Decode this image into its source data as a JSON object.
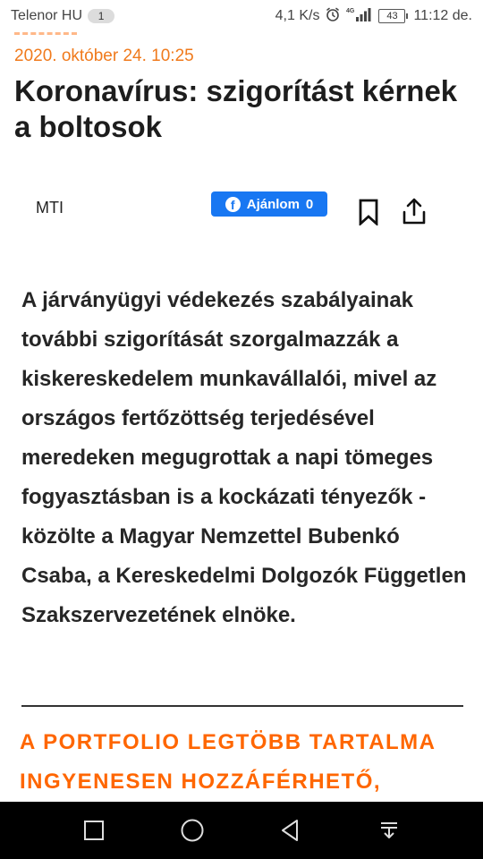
{
  "status_bar": {
    "carrier": "Telenor HU",
    "notification_count": "1",
    "speed": "4,1 K/s",
    "network_type": "4G",
    "battery": "43",
    "time": "11:12 de."
  },
  "article": {
    "date": "2020. október 24. 10:25",
    "title": "Koronavírus: szigorítást kérnek a boltosok",
    "author": "MTI",
    "lead": "A járványügyi védekezés szabályainak további szigorítását szorgalmazzák a kiskereskedelem munkavállalói, mivel az országos fertőzöttség terjedésével meredeken megugrottak a napi tömeges fogyasztásban is a kockázati tényezők - közölte a Magyar Nemzettel Bubenkó Csaba, a Kereskedelmi Dolgozók Független Szakszervezetének elnöke.",
    "promo": "A PORTFOLIO LEGTÖBB TARTALMA INGYENESEN HOZZÁFÉRHETŐ,"
  },
  "facebook_like": {
    "logo": "f",
    "label": "Ajánlom",
    "count": "0"
  },
  "icons": {
    "bookmark": "bookmark-icon",
    "share": "share-icon",
    "alarm": "alarm-icon",
    "signal": "signal-icon",
    "battery": "battery-icon",
    "recent_apps": "recent-apps-icon",
    "home": "home-icon",
    "back": "back-icon",
    "notification_pull": "notification-pull-icon"
  },
  "colors": {
    "accent_orange": "#ff6600",
    "date_orange": "#f07a1c",
    "facebook_blue": "#1877f2"
  }
}
